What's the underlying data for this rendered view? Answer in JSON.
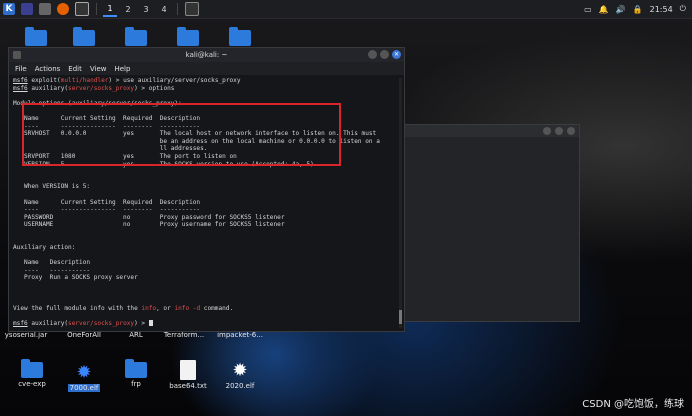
{
  "taskbar": {
    "workspaces": [
      "1",
      "2",
      "3",
      "4"
    ],
    "clock": "21:54"
  },
  "desktop": {
    "row2_labels": [
      "ysoserial.jar",
      "OneForAll",
      "ARL",
      "Terraform...",
      "impacket-6..."
    ],
    "row3_labels": [
      "cve-exp",
      "7000.elf",
      "frp",
      "base64.txt",
      "2020.elf"
    ]
  },
  "terminal": {
    "title": "kali@kali: ~",
    "menu": [
      "File",
      "Actions",
      "Edit",
      "View",
      "Help"
    ],
    "lines": [
      {
        "segs": [
          {
            "t": "msf6",
            "c": "u"
          },
          {
            "t": " exploit("
          },
          {
            "t": "multi/handler",
            "c": "red"
          },
          {
            "t": ") > use auxiliary/server/socks_proxy"
          }
        ]
      },
      {
        "segs": [
          {
            "t": "msf6",
            "c": "u"
          },
          {
            "t": " auxiliary("
          },
          {
            "t": "server/socks_proxy",
            "c": "red"
          },
          {
            "t": ") > options"
          }
        ]
      },
      {
        "segs": [
          {
            "t": ""
          }
        ]
      },
      {
        "segs": [
          {
            "t": "Module options (auxiliary/server/socks_proxy):"
          }
        ]
      },
      {
        "segs": [
          {
            "t": ""
          }
        ]
      },
      {
        "segs": [
          {
            "t": "   Name      Current Setting  Required  Description"
          }
        ]
      },
      {
        "segs": [
          {
            "t": "   ----      ---------------  --------  -----------"
          }
        ]
      },
      {
        "segs": [
          {
            "t": "   SRVHOST   0.0.0.0          yes       The local host or network interface to listen on. This must"
          }
        ]
      },
      {
        "segs": [
          {
            "t": "                                        be an address on the local machine or 0.0.0.0 to listen on a"
          }
        ]
      },
      {
        "segs": [
          {
            "t": "                                        ll addresses."
          }
        ]
      },
      {
        "segs": [
          {
            "t": "   SRVPORT   1080             yes       The port to listen on"
          }
        ]
      },
      {
        "segs": [
          {
            "t": "   VERSION   5                yes       The SOCKS version to use (Accepted: 4a, 5)"
          }
        ]
      },
      {
        "segs": [
          {
            "t": ""
          }
        ]
      },
      {
        "segs": [
          {
            "t": ""
          }
        ]
      },
      {
        "segs": [
          {
            "t": "   When VERSION is 5:"
          }
        ]
      },
      {
        "segs": [
          {
            "t": ""
          }
        ]
      },
      {
        "segs": [
          {
            "t": "   Name      Current Setting  Required  Description"
          }
        ]
      },
      {
        "segs": [
          {
            "t": "   ----      ---------------  --------  -----------"
          }
        ]
      },
      {
        "segs": [
          {
            "t": "   PASSWORD                   no        Proxy password for SOCKS5 listener"
          }
        ]
      },
      {
        "segs": [
          {
            "t": "   USERNAME                   no        Proxy username for SOCKS5 listener"
          }
        ]
      },
      {
        "segs": [
          {
            "t": ""
          }
        ]
      },
      {
        "segs": [
          {
            "t": ""
          }
        ]
      },
      {
        "segs": [
          {
            "t": "Auxiliary action:"
          }
        ]
      },
      {
        "segs": [
          {
            "t": ""
          }
        ]
      },
      {
        "segs": [
          {
            "t": "   Name   Description"
          }
        ]
      },
      {
        "segs": [
          {
            "t": "   ----   -----------"
          }
        ]
      },
      {
        "segs": [
          {
            "t": "   Proxy  Run a SOCKS proxy server"
          }
        ]
      },
      {
        "segs": [
          {
            "t": ""
          }
        ]
      },
      {
        "segs": [
          {
            "t": ""
          }
        ]
      },
      {
        "segs": [
          {
            "t": ""
          }
        ]
      },
      {
        "segs": [
          {
            "t": "View the full module info with the "
          },
          {
            "t": "info",
            "c": "red"
          },
          {
            "t": ", or "
          },
          {
            "t": "info -d",
            "c": "red"
          },
          {
            "t": " command."
          }
        ]
      },
      {
        "segs": [
          {
            "t": ""
          }
        ]
      },
      {
        "segs": [
          {
            "t": "msf6",
            "c": "u"
          },
          {
            "t": " auxiliary("
          },
          {
            "t": "server/socks_proxy",
            "c": "red"
          },
          {
            "t": ") > "
          }
        ],
        "cursor": true
      }
    ]
  },
  "watermark": "CSDN @吃饱饭，练球"
}
